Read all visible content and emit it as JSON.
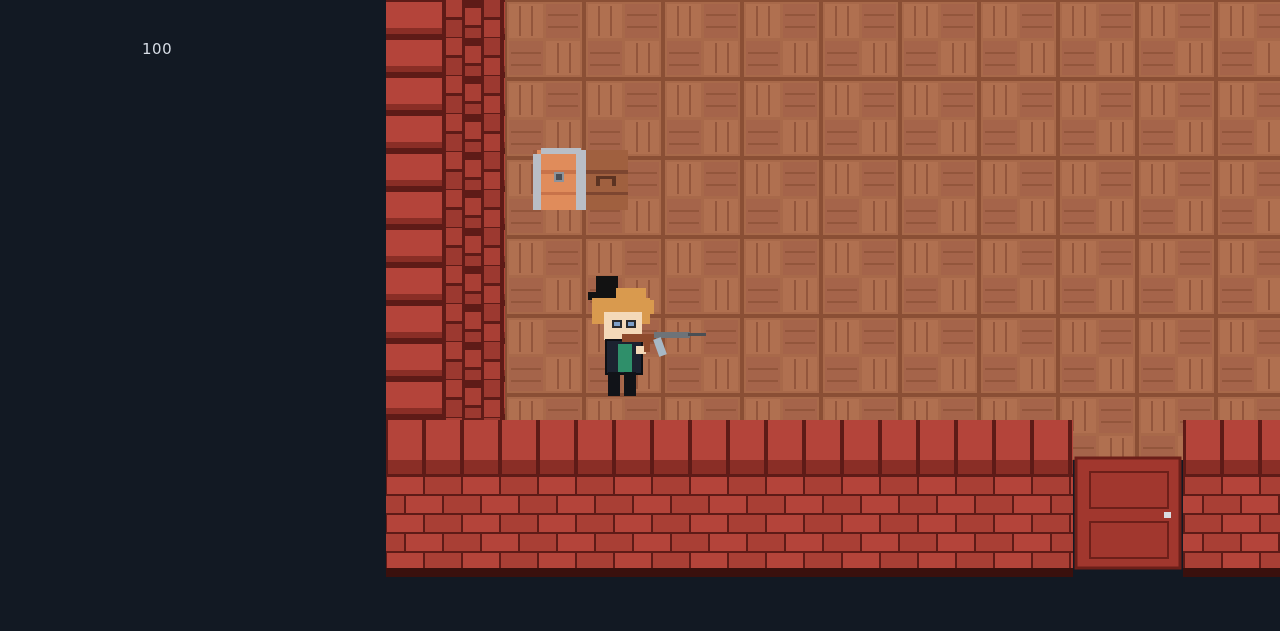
{
  "hud": {
    "health_value": "100"
  },
  "scene": {
    "room": "wooden-floor-room",
    "objects": [
      {
        "name": "treasure-chest",
        "state": "closed"
      },
      {
        "name": "player-character",
        "headwear": "black top hat",
        "weapon": "rifle"
      },
      {
        "name": "wooden-door",
        "state": "closed"
      }
    ]
  },
  "colors": {
    "background": "#121923",
    "floor_base": "#a8694a",
    "floor_tile": "#b57656",
    "floor_line": "#8a4f35",
    "brick": "#b4443a",
    "brick_dark": "#8a2e26",
    "door": "#a1372e",
    "chest_left": "#e08c5b",
    "chest_right": "#9b5a3e",
    "chest_metal": "#b9bec6"
  }
}
